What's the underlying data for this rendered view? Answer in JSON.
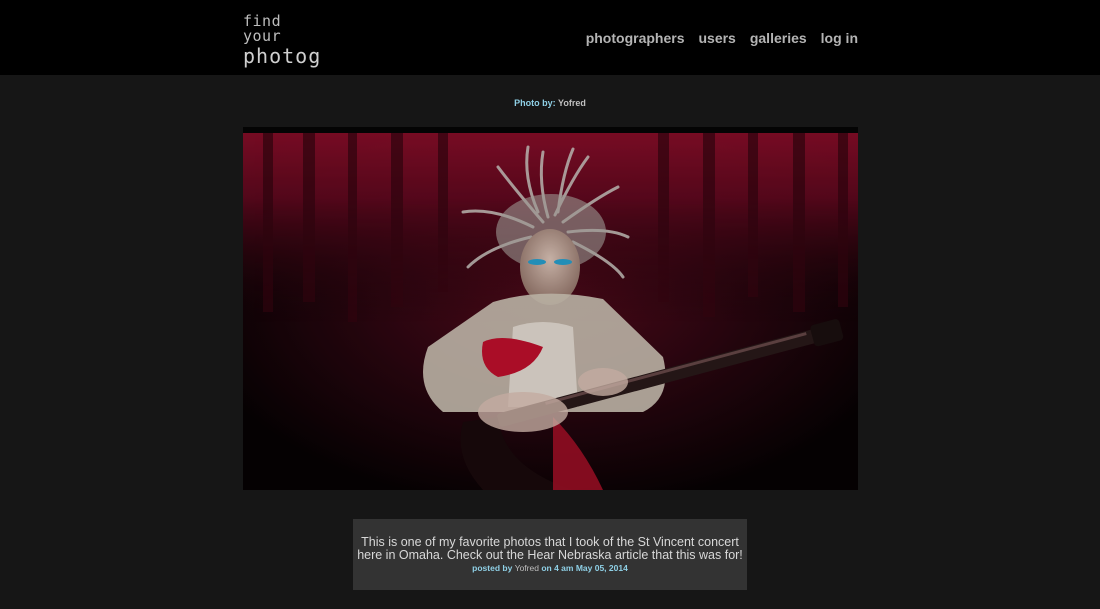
{
  "header": {
    "logo_line1": "find your",
    "logo_line2": "photog",
    "nav": [
      {
        "label": "photographers"
      },
      {
        "label": "users"
      },
      {
        "label": "galleries"
      },
      {
        "label": "log in"
      }
    ]
  },
  "photo": {
    "credit_label": "Photo by:",
    "credit_name": "Yofred"
  },
  "caption": {
    "text": "This is one of my favorite photos that I took of the St Vincent concert here in Omaha. Check out the Hear Nebraska article that this was for!",
    "posted_by_label": "posted by",
    "author": "Yofred",
    "on_label": "on",
    "timestamp": "4 am May 05, 2014"
  },
  "colors": {
    "accent": "#8fd0e6",
    "page_bg": "#161616",
    "header_bg": "#000000",
    "caption_bg": "#333333"
  }
}
